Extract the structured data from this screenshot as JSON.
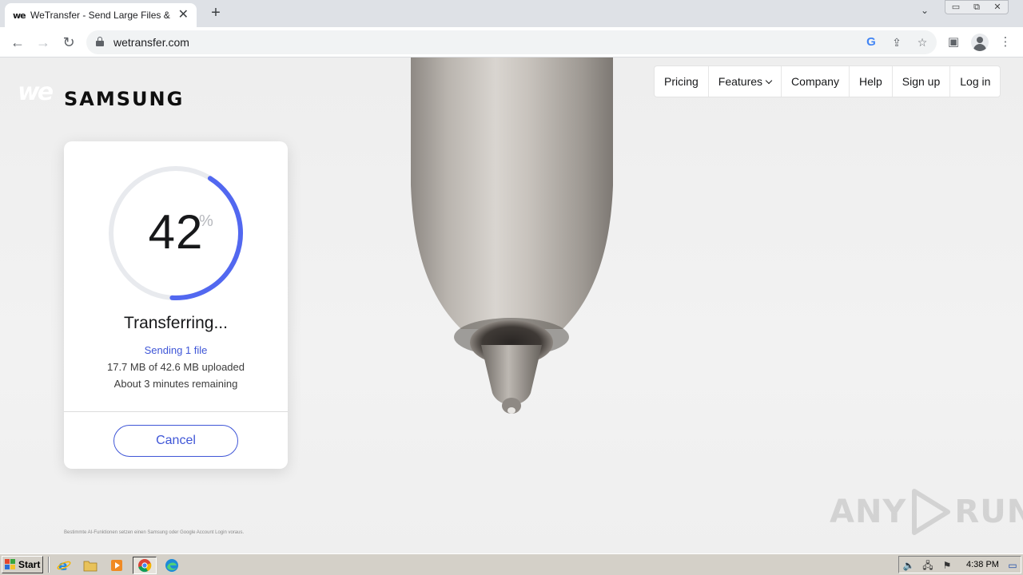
{
  "browser": {
    "tab_title": "WeTransfer - Send Large Files & Sha",
    "tab_favicon": "we",
    "url": "wetransfer.com"
  },
  "brand": {
    "we_logo": "we",
    "partner_logo": "SAMSUNG"
  },
  "nav": {
    "items": [
      "Pricing",
      "Features",
      "Company",
      "Help",
      "Sign up",
      "Log in"
    ]
  },
  "transfer": {
    "progress_percent": 42,
    "percent_value": "42",
    "percent_sign": "%",
    "title": "Transferring...",
    "sending": "Sending 1 file",
    "uploaded": "17.7 MB of 42.6 MB uploaded",
    "remaining": "About 3 minutes remaining",
    "cancel_label": "Cancel"
  },
  "footer": {
    "disclaimer": "Bestimmte AI-Funktionen setzen einen Samsung oder Google Account Login voraus."
  },
  "watermark": {
    "left": "ANY",
    "right": "RUN"
  },
  "taskbar": {
    "start_label": "Start",
    "clock": "4:38 PM"
  },
  "colors": {
    "accent": "#3f56d7",
    "ring_progress": "#5268f0",
    "ring_track": "#e8eaee"
  }
}
